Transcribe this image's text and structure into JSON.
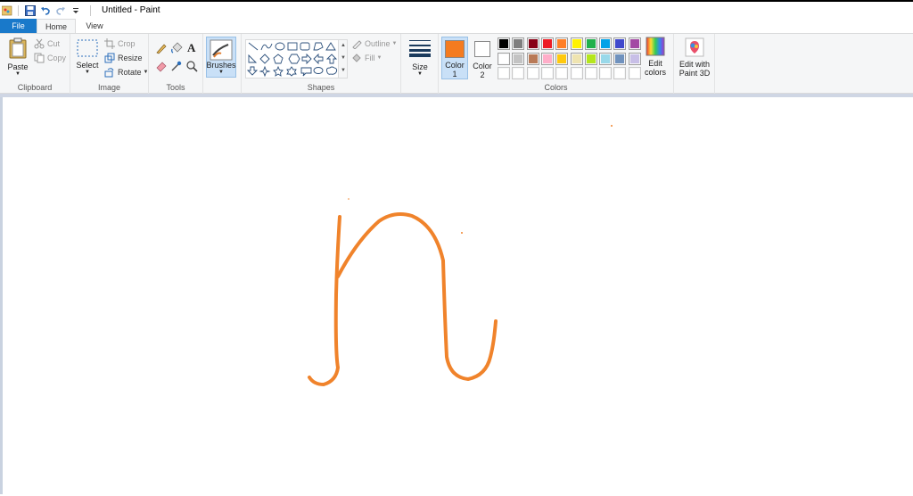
{
  "window": {
    "title": "Untitled - Paint"
  },
  "quick_access": {
    "icons": [
      "paint-app-icon",
      "save-icon",
      "undo-icon",
      "redo-icon",
      "customize-icon"
    ]
  },
  "tabs": [
    {
      "label": "File"
    },
    {
      "label": "Home"
    },
    {
      "label": "View"
    }
  ],
  "clipboard": {
    "label": "Clipboard",
    "paste": "Paste",
    "cut": "Cut",
    "copy": "Copy"
  },
  "image": {
    "label": "Image",
    "select": "Select",
    "crop": "Crop",
    "resize": "Resize",
    "rotate": "Rotate"
  },
  "tools": {
    "label": "Tools",
    "brushes": "Brushes"
  },
  "shapes": {
    "label": "Shapes",
    "outline": "Outline",
    "fill": "Fill"
  },
  "size": {
    "label": "Size"
  },
  "colors": {
    "label": "Colors",
    "color1_label": "Color",
    "color1_num": "1",
    "color2_label": "Color",
    "color2_num": "2",
    "edit_colors_1": "Edit",
    "edit_colors_2": "colors",
    "color1": "#f47b20",
    "color2": "#ffffff",
    "palette_row1": [
      "#000000",
      "#7f7f7f",
      "#880015",
      "#ed1c24",
      "#ff7f27",
      "#fff200",
      "#22b14c",
      "#00a2e8",
      "#3f48cc",
      "#a349a4"
    ],
    "palette_row2": [
      "#ffffff",
      "#c3c3c3",
      "#b97a57",
      "#ffaec9",
      "#ffc90e",
      "#efe4b0",
      "#b5e61d",
      "#99d9ea",
      "#7092be",
      "#c8bfe7"
    ],
    "palette_row3": [
      "",
      "",
      "",
      "",
      "",
      "",
      "",
      "",
      "",
      ""
    ]
  },
  "paint3d": {
    "label1": "Edit with",
    "label2": "Paint 3D"
  },
  "drawing": {
    "stroke_color": "#f0832b"
  }
}
